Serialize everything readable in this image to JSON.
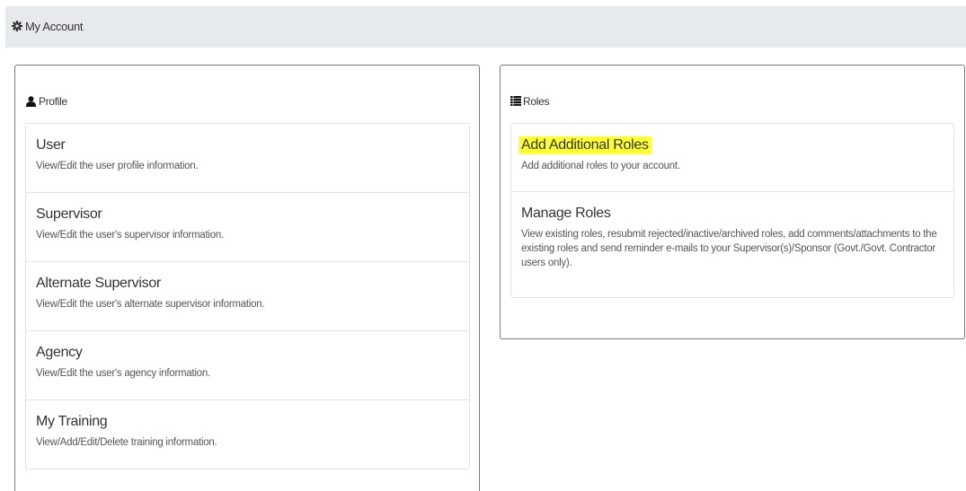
{
  "header": {
    "title": "My Account",
    "icon": "gear-icon"
  },
  "profile": {
    "heading": "Profile",
    "icon": "user-icon",
    "items": [
      {
        "title": "User",
        "desc": "View/Edit the user profile information."
      },
      {
        "title": "Supervisor",
        "desc": "View/Edit the user's supervisor information."
      },
      {
        "title": "Alternate Supervisor",
        "desc": "View/Edit the user's alternate supervisor information."
      },
      {
        "title": "Agency",
        "desc": "View/Edit the user's agency information."
      },
      {
        "title": "My Training",
        "desc": "View/Add/Edit/Delete training information."
      }
    ]
  },
  "roles": {
    "heading": "Roles",
    "icon": "list-icon",
    "highlight_color": "#ffff33",
    "items": [
      {
        "title": "Add Additional Roles",
        "desc": "Add additional roles to your account."
      },
      {
        "title": "Manage Roles",
        "desc": "View existing roles, resubmit rejected/inactive/archived roles, add comments/attachments to the existing roles and send reminder e-mails to your Supervisor(s)/Sponsor (Govt./Govt. Contractor users only)."
      }
    ]
  }
}
